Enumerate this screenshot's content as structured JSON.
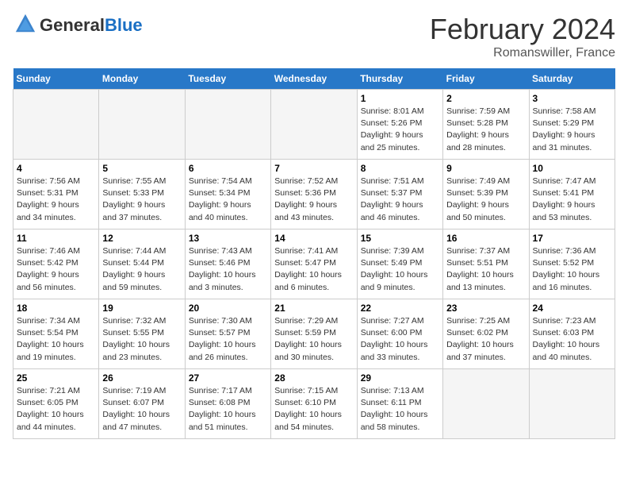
{
  "header": {
    "logo_line1": "General",
    "logo_line2": "Blue",
    "title": "February 2024",
    "subtitle": "Romanswiller, France"
  },
  "days_of_week": [
    "Sunday",
    "Monday",
    "Tuesday",
    "Wednesday",
    "Thursday",
    "Friday",
    "Saturday"
  ],
  "weeks": [
    [
      {
        "day": "",
        "info": "",
        "empty": true
      },
      {
        "day": "",
        "info": "",
        "empty": true
      },
      {
        "day": "",
        "info": "",
        "empty": true
      },
      {
        "day": "",
        "info": "",
        "empty": true
      },
      {
        "day": "1",
        "info": "Sunrise: 8:01 AM\nSunset: 5:26 PM\nDaylight: 9 hours\nand 25 minutes.",
        "empty": false
      },
      {
        "day": "2",
        "info": "Sunrise: 7:59 AM\nSunset: 5:28 PM\nDaylight: 9 hours\nand 28 minutes.",
        "empty": false
      },
      {
        "day": "3",
        "info": "Sunrise: 7:58 AM\nSunset: 5:29 PM\nDaylight: 9 hours\nand 31 minutes.",
        "empty": false
      }
    ],
    [
      {
        "day": "4",
        "info": "Sunrise: 7:56 AM\nSunset: 5:31 PM\nDaylight: 9 hours\nand 34 minutes.",
        "empty": false
      },
      {
        "day": "5",
        "info": "Sunrise: 7:55 AM\nSunset: 5:33 PM\nDaylight: 9 hours\nand 37 minutes.",
        "empty": false
      },
      {
        "day": "6",
        "info": "Sunrise: 7:54 AM\nSunset: 5:34 PM\nDaylight: 9 hours\nand 40 minutes.",
        "empty": false
      },
      {
        "day": "7",
        "info": "Sunrise: 7:52 AM\nSunset: 5:36 PM\nDaylight: 9 hours\nand 43 minutes.",
        "empty": false
      },
      {
        "day": "8",
        "info": "Sunrise: 7:51 AM\nSunset: 5:37 PM\nDaylight: 9 hours\nand 46 minutes.",
        "empty": false
      },
      {
        "day": "9",
        "info": "Sunrise: 7:49 AM\nSunset: 5:39 PM\nDaylight: 9 hours\nand 50 minutes.",
        "empty": false
      },
      {
        "day": "10",
        "info": "Sunrise: 7:47 AM\nSunset: 5:41 PM\nDaylight: 9 hours\nand 53 minutes.",
        "empty": false
      }
    ],
    [
      {
        "day": "11",
        "info": "Sunrise: 7:46 AM\nSunset: 5:42 PM\nDaylight: 9 hours\nand 56 minutes.",
        "empty": false
      },
      {
        "day": "12",
        "info": "Sunrise: 7:44 AM\nSunset: 5:44 PM\nDaylight: 9 hours\nand 59 minutes.",
        "empty": false
      },
      {
        "day": "13",
        "info": "Sunrise: 7:43 AM\nSunset: 5:46 PM\nDaylight: 10 hours\nand 3 minutes.",
        "empty": false
      },
      {
        "day": "14",
        "info": "Sunrise: 7:41 AM\nSunset: 5:47 PM\nDaylight: 10 hours\nand 6 minutes.",
        "empty": false
      },
      {
        "day": "15",
        "info": "Sunrise: 7:39 AM\nSunset: 5:49 PM\nDaylight: 10 hours\nand 9 minutes.",
        "empty": false
      },
      {
        "day": "16",
        "info": "Sunrise: 7:37 AM\nSunset: 5:51 PM\nDaylight: 10 hours\nand 13 minutes.",
        "empty": false
      },
      {
        "day": "17",
        "info": "Sunrise: 7:36 AM\nSunset: 5:52 PM\nDaylight: 10 hours\nand 16 minutes.",
        "empty": false
      }
    ],
    [
      {
        "day": "18",
        "info": "Sunrise: 7:34 AM\nSunset: 5:54 PM\nDaylight: 10 hours\nand 19 minutes.",
        "empty": false
      },
      {
        "day": "19",
        "info": "Sunrise: 7:32 AM\nSunset: 5:55 PM\nDaylight: 10 hours\nand 23 minutes.",
        "empty": false
      },
      {
        "day": "20",
        "info": "Sunrise: 7:30 AM\nSunset: 5:57 PM\nDaylight: 10 hours\nand 26 minutes.",
        "empty": false
      },
      {
        "day": "21",
        "info": "Sunrise: 7:29 AM\nSunset: 5:59 PM\nDaylight: 10 hours\nand 30 minutes.",
        "empty": false
      },
      {
        "day": "22",
        "info": "Sunrise: 7:27 AM\nSunset: 6:00 PM\nDaylight: 10 hours\nand 33 minutes.",
        "empty": false
      },
      {
        "day": "23",
        "info": "Sunrise: 7:25 AM\nSunset: 6:02 PM\nDaylight: 10 hours\nand 37 minutes.",
        "empty": false
      },
      {
        "day": "24",
        "info": "Sunrise: 7:23 AM\nSunset: 6:03 PM\nDaylight: 10 hours\nand 40 minutes.",
        "empty": false
      }
    ],
    [
      {
        "day": "25",
        "info": "Sunrise: 7:21 AM\nSunset: 6:05 PM\nDaylight: 10 hours\nand 44 minutes.",
        "empty": false
      },
      {
        "day": "26",
        "info": "Sunrise: 7:19 AM\nSunset: 6:07 PM\nDaylight: 10 hours\nand 47 minutes.",
        "empty": false
      },
      {
        "day": "27",
        "info": "Sunrise: 7:17 AM\nSunset: 6:08 PM\nDaylight: 10 hours\nand 51 minutes.",
        "empty": false
      },
      {
        "day": "28",
        "info": "Sunrise: 7:15 AM\nSunset: 6:10 PM\nDaylight: 10 hours\nand 54 minutes.",
        "empty": false
      },
      {
        "day": "29",
        "info": "Sunrise: 7:13 AM\nSunset: 6:11 PM\nDaylight: 10 hours\nand 58 minutes.",
        "empty": false
      },
      {
        "day": "",
        "info": "",
        "empty": true
      },
      {
        "day": "",
        "info": "",
        "empty": true
      }
    ]
  ]
}
